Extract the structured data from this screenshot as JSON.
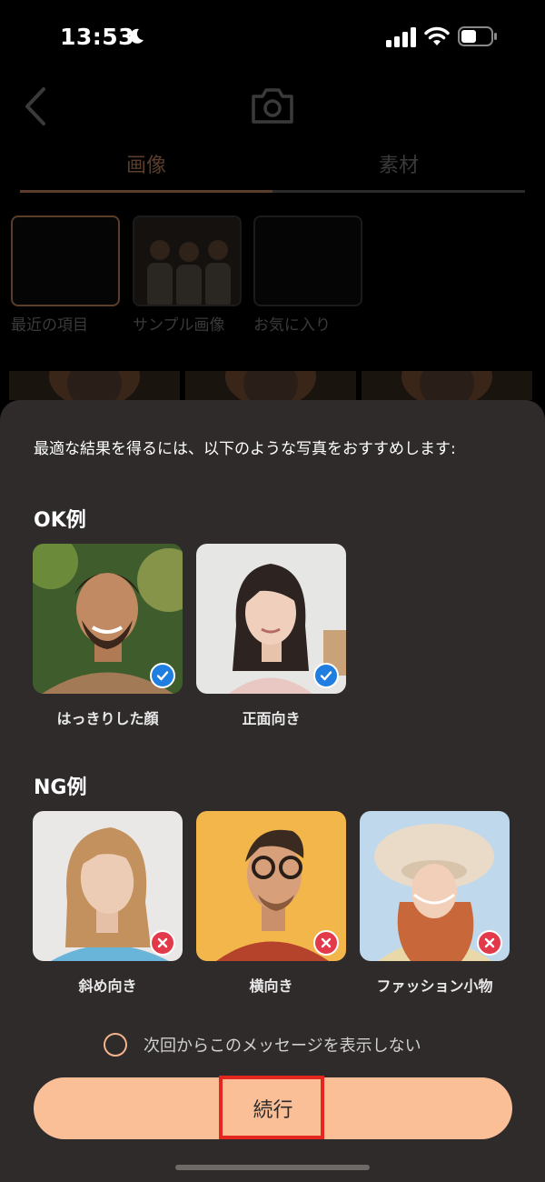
{
  "status_bar": {
    "time": "13:53",
    "moon_icon": "moon-icon",
    "signal_icon": "cellular-signal-icon",
    "wifi_icon": "wifi-icon",
    "battery_icon": "battery-icon"
  },
  "background_screen": {
    "back_icon": "chevron-left-icon",
    "camera_icon": "camera-icon",
    "tabs": [
      {
        "label": "画像",
        "active": true
      },
      {
        "label": "素材",
        "active": false
      }
    ],
    "albums": [
      {
        "label": "最近の項目"
      },
      {
        "label": "サンプル画像"
      },
      {
        "label": "お気に入り"
      }
    ]
  },
  "sheet": {
    "intro_text": "最適な結果を得るには、以下のような写真をおすすめします:",
    "ok_title": "OK例",
    "ok_examples": [
      {
        "label": "はっきりした顔",
        "badge": "check-icon"
      },
      {
        "label": "正面向き",
        "badge": "check-icon"
      }
    ],
    "ng_title": "NG例",
    "ng_examples": [
      {
        "label": "斜め向き",
        "badge": "x-icon"
      },
      {
        "label": "横向き",
        "badge": "x-icon"
      },
      {
        "label": "ファッション小物",
        "badge": "x-icon"
      }
    ],
    "dont_show_label": "次回からこのメッセージを表示しない",
    "continue_label": "続行"
  },
  "colors": {
    "sheet_bg": "#2f2b2b",
    "accent": "#fbbf98",
    "ok_badge": "#1f7ee0",
    "ng_badge": "#e23a4b",
    "highlight": "#e5261f"
  }
}
